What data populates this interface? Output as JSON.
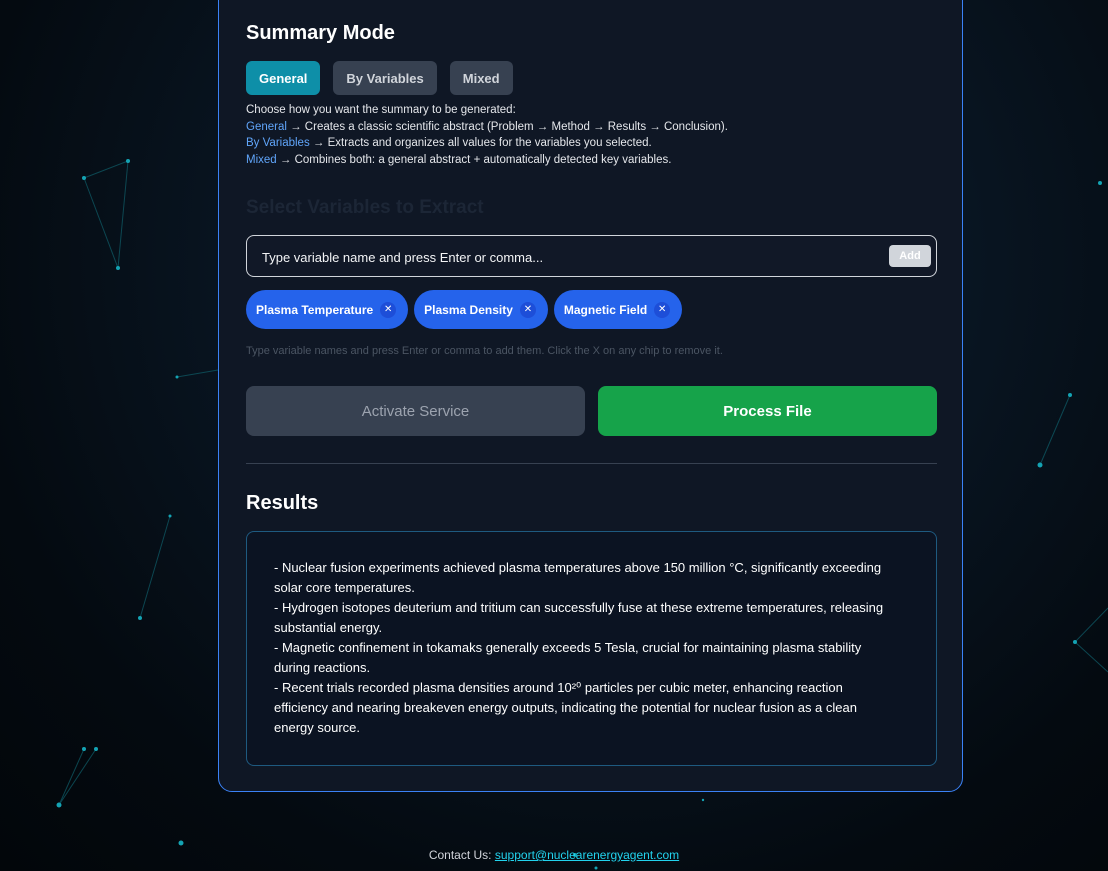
{
  "summary_mode": {
    "title": "Summary Mode",
    "tabs": [
      {
        "label": "General",
        "active": true
      },
      {
        "label": "By Variables",
        "active": false
      },
      {
        "label": "Mixed",
        "active": false
      }
    ],
    "intro": "Choose how you want the summary to be generated:",
    "descriptions": [
      {
        "keyword": "General",
        "text": " → Creates a classic scientific abstract (Problem → Method → Results → Conclusion)."
      },
      {
        "keyword": "By Variables",
        "text": " → Extracts and organizes all values for the variables you selected."
      },
      {
        "keyword": "Mixed",
        "text": " → Combines both: a general abstract + automatically detected key variables."
      }
    ]
  },
  "variables": {
    "heading": "Select Variables to Extract",
    "input_placeholder": "Type variable name and press Enter or comma...",
    "add_label": "Add",
    "chips": [
      {
        "label": "Plasma Temperature",
        "remove": "✕"
      },
      {
        "label": "Plasma Density",
        "remove": "✕"
      },
      {
        "label": "Magnetic Field",
        "remove": "✕"
      }
    ],
    "hint": "Type variable names and press Enter or comma to add them. Click the X on any chip to remove it."
  },
  "actions": {
    "activate_label": "Activate Service",
    "process_label": "Process File"
  },
  "results": {
    "title": "Results",
    "lines": [
      "- Nuclear fusion experiments achieved plasma temperatures above 150 million °C, significantly exceeding",
      "solar core temperatures.",
      "- Hydrogen isotopes deuterium and tritium can successfully fuse at these extreme temperatures, releasing",
      "substantial energy.",
      "- Magnetic confinement in tokamaks generally exceeds 5 Tesla, crucial for maintaining plasma stability",
      "during reactions.",
      "- Recent trials recorded plasma densities around 10²⁰ particles per cubic meter, enhancing reaction",
      "efficiency and nearing breakeven energy outputs, indicating the potential for nuclear fusion as a clean",
      "energy source."
    ]
  },
  "footer": {
    "contact_label": "Contact Us:",
    "email": "support@nuclearenergyagent.com"
  },
  "colors": {
    "accent_active_tab": "#0e8fa8",
    "chip_blue": "#2563eb",
    "process_green": "#16a34a",
    "panel_border": "#3b82f6",
    "link_cyan": "#22d3ee"
  }
}
